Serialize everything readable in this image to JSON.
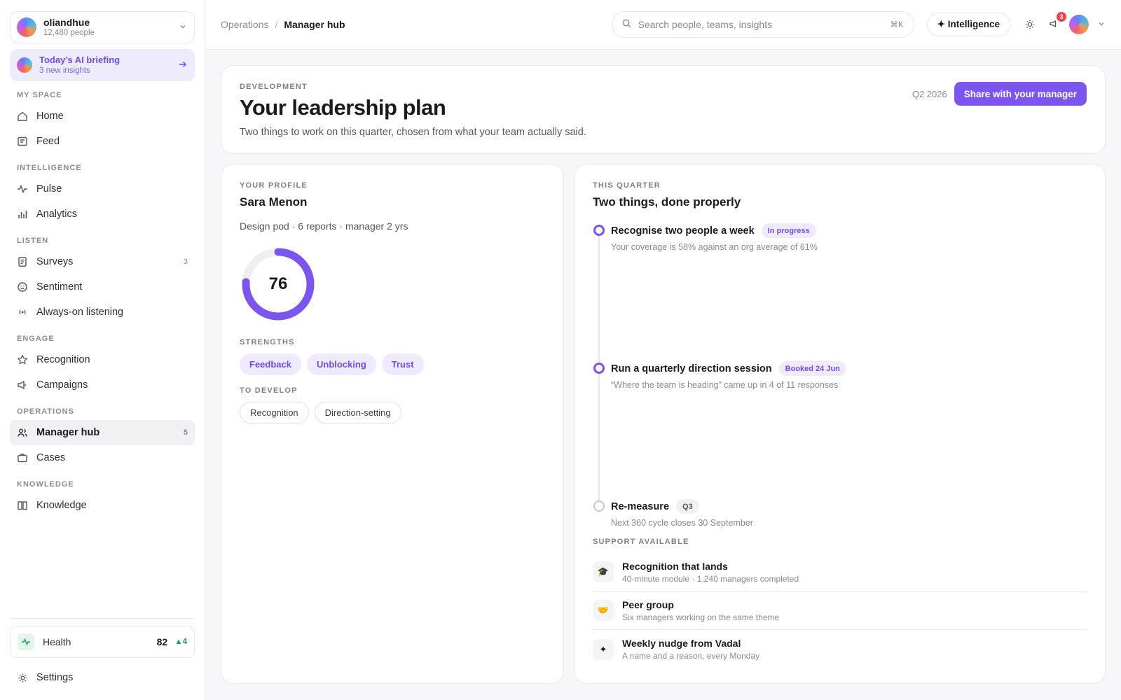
{
  "org": {
    "name": "oliandhue",
    "people": "12,480 people"
  },
  "briefing": {
    "title": "Today’s AI briefing",
    "subtitle": "3 new insights"
  },
  "sidebar": {
    "sections": [
      {
        "label": "MY SPACE",
        "items": [
          {
            "label": "Home",
            "icon": "home-icon"
          },
          {
            "label": "Feed",
            "icon": "feed-icon"
          }
        ]
      },
      {
        "label": "INTELLIGENCE",
        "items": [
          {
            "label": "Pulse",
            "icon": "pulse-icon"
          },
          {
            "label": "Analytics",
            "icon": "analytics-icon"
          }
        ]
      },
      {
        "label": "LISTEN",
        "items": [
          {
            "label": "Surveys",
            "icon": "survey-icon",
            "count": "3"
          },
          {
            "label": "Sentiment",
            "icon": "smile-icon"
          },
          {
            "label": "Always-on listening",
            "icon": "broadcast-icon"
          }
        ]
      },
      {
        "label": "ENGAGE",
        "items": [
          {
            "label": "Recognition",
            "icon": "star-icon"
          },
          {
            "label": "Campaigns",
            "icon": "megaphone-icon"
          }
        ]
      },
      {
        "label": "OPERATIONS",
        "items": [
          {
            "label": "Manager hub",
            "icon": "users-icon",
            "count": "5",
            "active": true
          },
          {
            "label": "Cases",
            "icon": "briefcase-icon"
          }
        ]
      },
      {
        "label": "KNOWLEDGE",
        "items": [
          {
            "label": "Knowledge",
            "icon": "book-icon"
          }
        ]
      }
    ],
    "health": {
      "label": "Health",
      "value": "82",
      "delta": "▲4"
    },
    "settings": "Settings"
  },
  "topbar": {
    "breadcrumb_parent": "Operations",
    "breadcrumb_sep": "/",
    "breadcrumb_current": "Manager hub",
    "search_placeholder": "Search people, teams, insights",
    "search_shortcut": "⌘K",
    "intelligence_label": "✦ Intelligence",
    "notification_count": "3"
  },
  "hero": {
    "eyebrow": "DEVELOPMENT",
    "title": "Your leadership plan",
    "subtitle": "Two things to work on this quarter, chosen from what your team actually said.",
    "quarter": "Q2 2026",
    "share_button": "Share with your manager"
  },
  "profile": {
    "eyebrow": "YOUR PROFILE",
    "name": "Sara Menon",
    "meta": "Design pod · 6 reports · manager 2 yrs",
    "score": 76,
    "score_label": "76",
    "strengths_label": "STRENGTHS",
    "strengths": [
      "Feedback",
      "Unblocking",
      "Trust"
    ],
    "develop_label": "TO DEVELOP",
    "develop": [
      "Recognition",
      "Direction-setting"
    ]
  },
  "quarter_plan": {
    "eyebrow": "THIS QUARTER",
    "title": "Two things, done properly",
    "steps": [
      {
        "title": "Recognise two people a week",
        "tag": "In progress",
        "desc": "Your coverage is 58% against an org average of 61%"
      },
      {
        "title": "Run a quarterly direction session",
        "tag": "Booked 24 Jun",
        "desc": "“Where the team is heading” came up in 4 of 11 responses"
      },
      {
        "title": "Re-measure",
        "tag": "Q3",
        "desc": "Next 360 cycle closes 30 September"
      }
    ],
    "support_label": "SUPPORT AVAILABLE",
    "support": [
      {
        "icon": "🎓",
        "title": "Recognition that lands",
        "desc": "40-minute module · 1,240 managers completed"
      },
      {
        "icon": "🤝",
        "title": "Peer group",
        "desc": "Six managers working on the same theme"
      },
      {
        "icon": "✦",
        "title": "Weekly nudge from Vadal",
        "desc": "A name and a reason, every Monday"
      }
    ]
  },
  "colors": {
    "accent": "#7b55ee",
    "accent_soft": "#efeafd",
    "health_green": "#21a35c",
    "badge_red": "#e5484d"
  }
}
